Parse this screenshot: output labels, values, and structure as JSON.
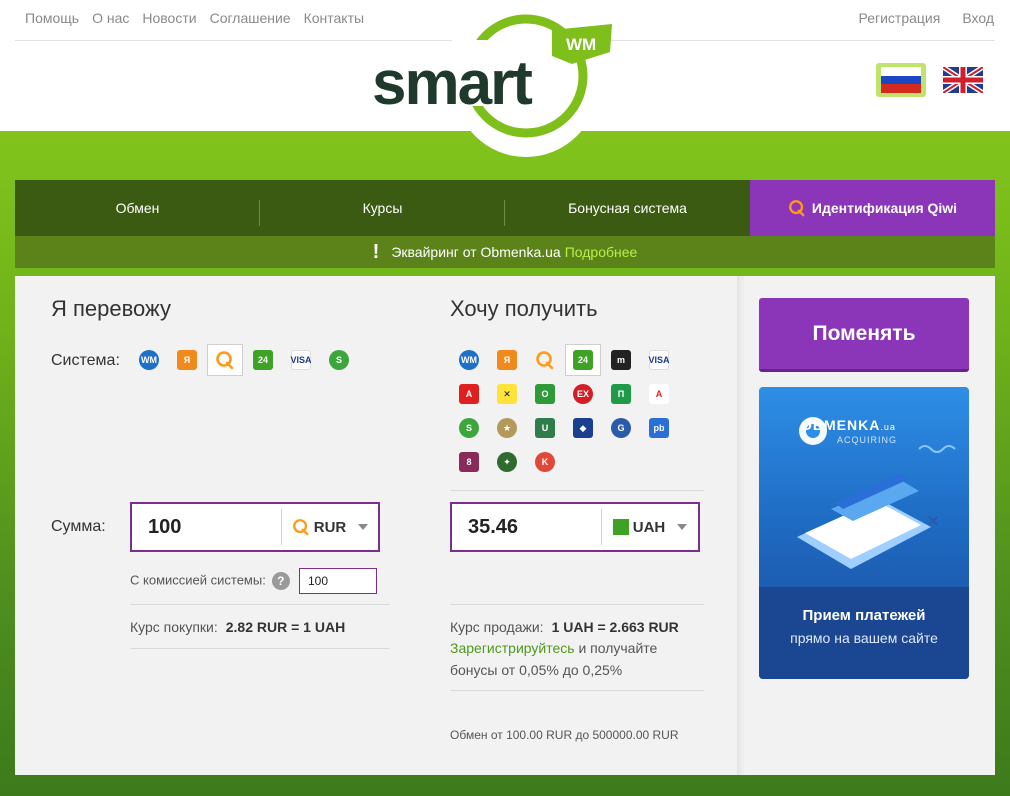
{
  "topnav": [
    "Помощь",
    "О нас",
    "Новости",
    "Соглашение",
    "Контакты"
  ],
  "auth": {
    "register": "Регистрация",
    "login": "Вход"
  },
  "logo": {
    "word": "smart",
    "badge": "WM"
  },
  "mainnav": {
    "exchange": "Обмен",
    "rates": "Курсы",
    "bonus": "Бонусная система",
    "qiwi": "Идентификация Qiwi"
  },
  "notice": {
    "text": "Эквайринг от Obmenka.ua",
    "link": "Подробнее"
  },
  "give": {
    "title": "Я перевожу",
    "system_label": "Система:",
    "amount_label": "Сумма:",
    "amount": "100",
    "currency": "RUR",
    "commission_label": "С комиссией системы:",
    "commission_value": "100",
    "rate_label": "Курс покупки:",
    "rate_value": "2.82 RUR = 1 UAH"
  },
  "get": {
    "title": "Хочу получить",
    "amount": "35.46",
    "currency": "UAH",
    "rate_label": "Курс продажи:",
    "rate_value": "1 UAH = 2.663 RUR",
    "register_link": "Зарегистрируйтесь",
    "bonus_text_1": "и получайте",
    "bonus_text_2": "бонусы от 0,05% до 0,25%",
    "limits": "Обмен от 100.00 RUR  до 500000.00 RUR"
  },
  "swap_button": "Поменять",
  "banner": {
    "brand": "OBMENKA",
    "brand_suffix": ".ua",
    "sub": "ACQUIRING",
    "line1": "Прием платежей",
    "line2": "прямо на вашем сайте"
  },
  "colors": {
    "green": "#6fb21a",
    "nav_dark": "#3b5a12",
    "purple": "#8b35b8",
    "link_green": "#4e9a1a"
  }
}
